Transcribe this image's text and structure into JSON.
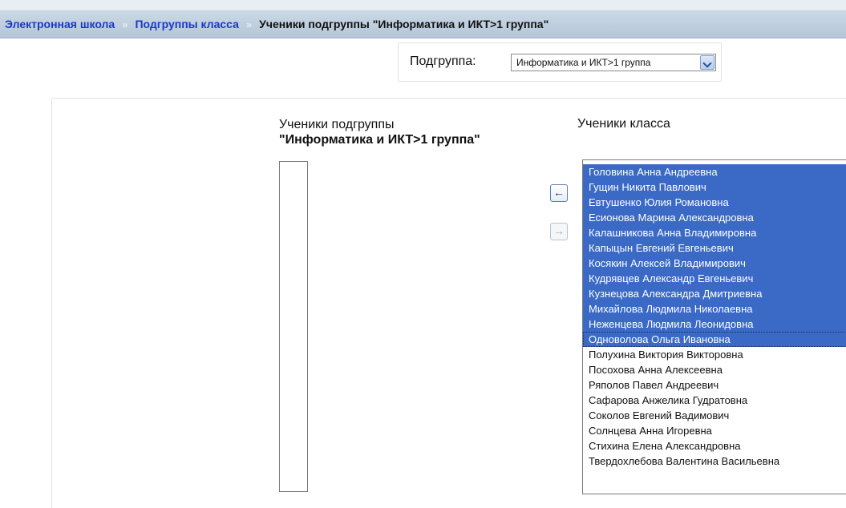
{
  "breadcrumb": {
    "home": "Электронная школа",
    "separator1": "»",
    "subgroups": "Подгруппы класса",
    "separator2": "»",
    "current": "Ученики подгруппы \"Информатика и ИКТ>1 группа\""
  },
  "subgroup": {
    "label": "Подгруппа:",
    "selected": "Информатика и ИКТ>1 группа"
  },
  "left": {
    "title_line1": "Ученики подгруппы",
    "title_line2": "\"Информатика и ИКТ>1 группа\""
  },
  "right": {
    "title": "Ученики класса"
  },
  "buttons": {
    "move_left": "←",
    "move_right": "→"
  },
  "students": [
    {
      "name": "Головина Анна Андреевна",
      "selected": true
    },
    {
      "name": "Гущин Никита Павлович",
      "selected": true
    },
    {
      "name": "Евтушенко Юлия Романовна",
      "selected": true
    },
    {
      "name": "Есионова Марина Александровна",
      "selected": true
    },
    {
      "name": "Калашникова Анна Владимировна",
      "selected": true
    },
    {
      "name": "Капыцын Евгений Евгеньевич",
      "selected": true
    },
    {
      "name": "Косякин Алексей Владимирович",
      "selected": true
    },
    {
      "name": "Кудрявцев Александр Евгеньевич",
      "selected": true
    },
    {
      "name": "Кузнецова Александра Дмитриевна",
      "selected": true
    },
    {
      "name": "Михайлова Людмила Николаевна",
      "selected": true
    },
    {
      "name": "Неженцева Людмила Леонидовна",
      "selected": true
    },
    {
      "name": "Одноволова Ольга Ивановна",
      "selected": true
    },
    {
      "name": "Полухина Виктория Викторовна",
      "selected": false
    },
    {
      "name": "Посохова Анна Алексеевна",
      "selected": false
    },
    {
      "name": "Ряполов Павел Андреевич",
      "selected": false
    },
    {
      "name": "Сафарова Анжелика Гудратовна",
      "selected": false
    },
    {
      "name": "Соколов Евгений Вадимович",
      "selected": false
    },
    {
      "name": "Солнцева Анна Игоревна",
      "selected": false
    },
    {
      "name": "Стихина Елена Александровна",
      "selected": false
    },
    {
      "name": "Твердохлебова Валентина Васильевна",
      "selected": false
    }
  ],
  "colors": {
    "link": "#1a38c8",
    "selection": "#3a69c6",
    "breadcrumb_bar": "#b4c6d7"
  }
}
